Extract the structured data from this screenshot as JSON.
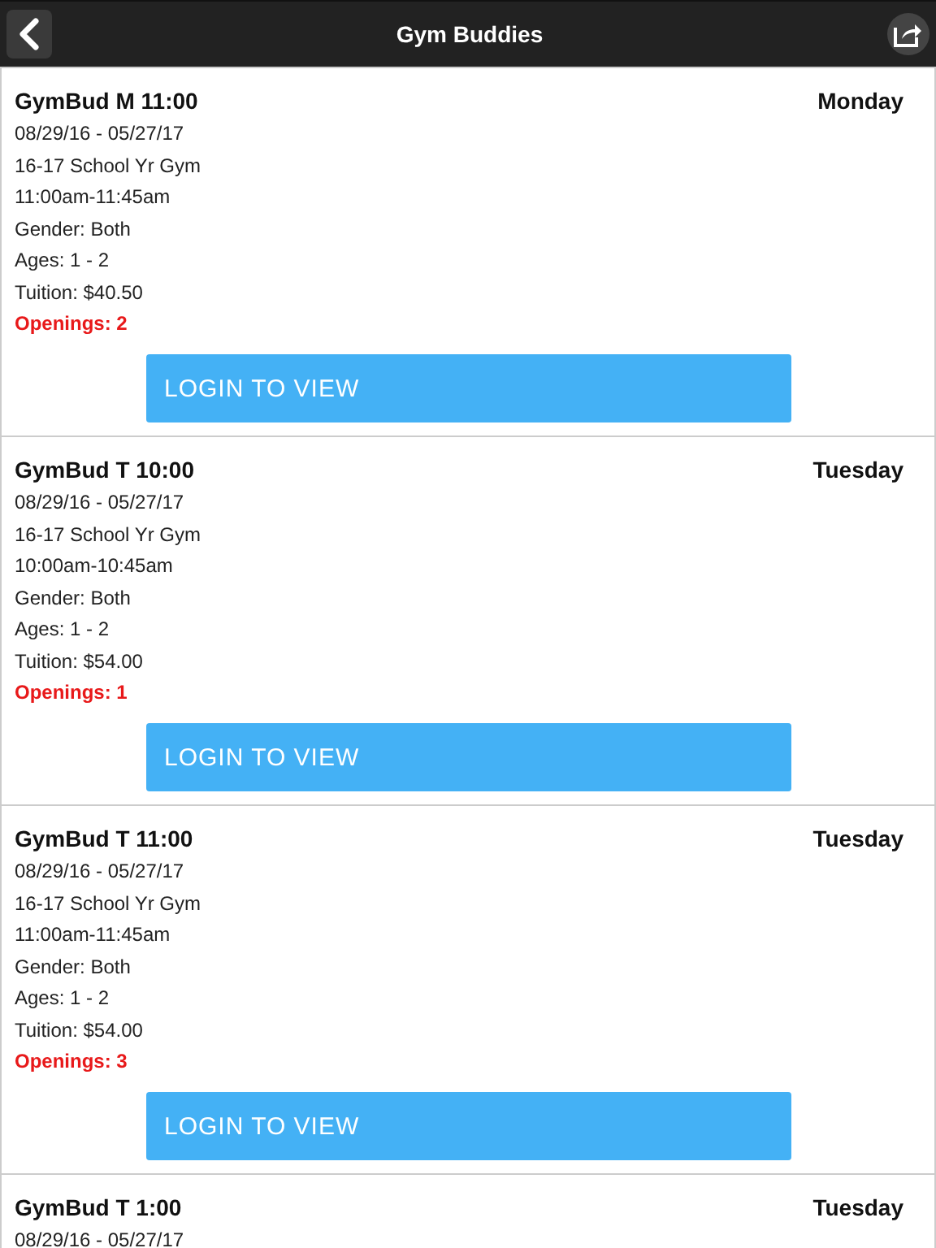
{
  "header": {
    "title": "Gym Buddies"
  },
  "classes": [
    {
      "name": "GymBud M 11:00",
      "day": "Monday",
      "details": [
        "08/29/16 - 05/27/17",
        "16-17 School Yr Gym",
        "11:00am-11:45am",
        "Gender: Both",
        "Ages: 1 - 2",
        "Tuition: $40.50"
      ],
      "openings": "Openings: 2",
      "button": "LOGIN TO VIEW"
    },
    {
      "name": "GymBud T 10:00",
      "day": "Tuesday",
      "details": [
        "08/29/16 - 05/27/17",
        "16-17 School Yr Gym",
        "10:00am-10:45am",
        "Gender: Both",
        "Ages: 1 - 2",
        "Tuition: $54.00"
      ],
      "openings": "Openings: 1",
      "button": "LOGIN TO VIEW"
    },
    {
      "name": "GymBud T 11:00",
      "day": "Tuesday",
      "details": [
        "08/29/16 - 05/27/17",
        "16-17 School Yr Gym",
        "11:00am-11:45am",
        "Gender: Both",
        "Ages: 1 - 2",
        "Tuition: $54.00"
      ],
      "openings": "Openings: 3",
      "button": "LOGIN TO VIEW"
    },
    {
      "name": "GymBud T 1:00",
      "day": "Tuesday",
      "details": [
        "08/29/16 - 05/27/17"
      ]
    }
  ]
}
